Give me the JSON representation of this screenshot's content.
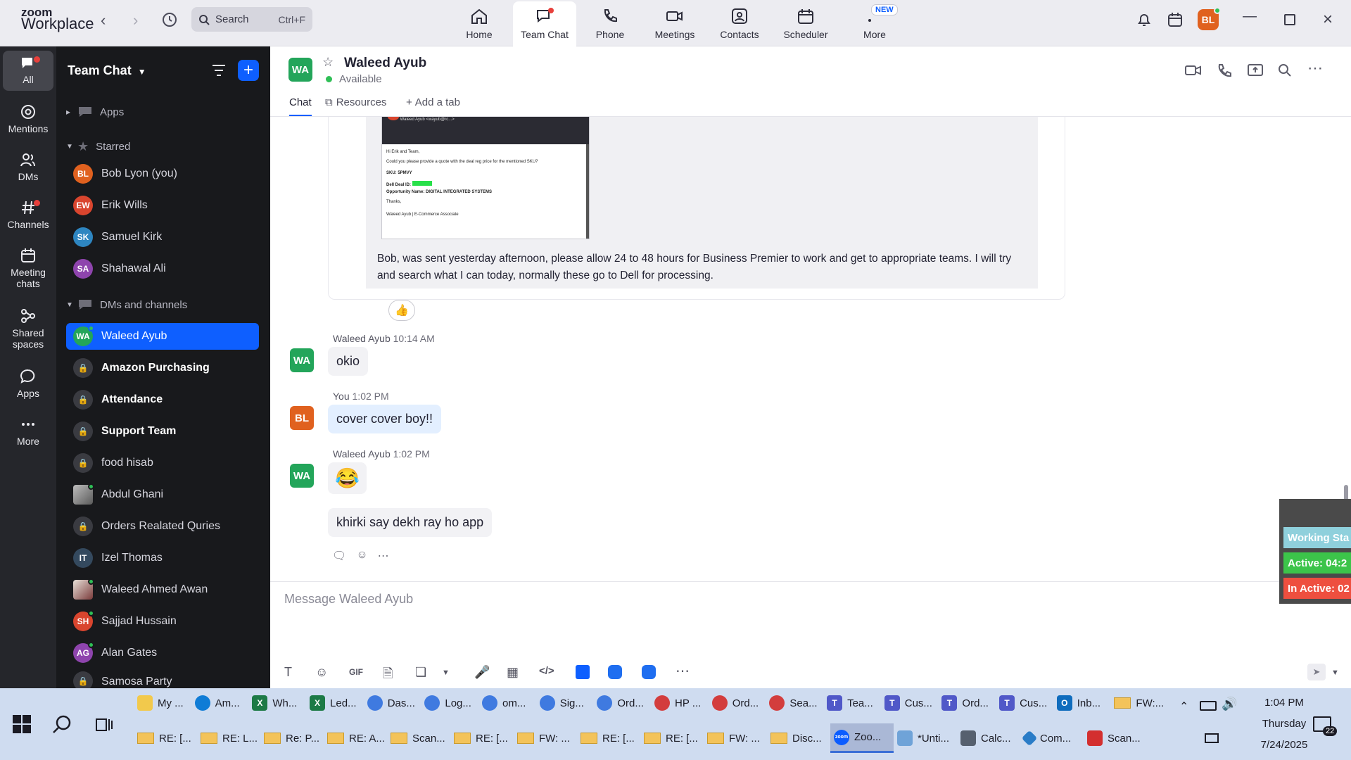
{
  "app": {
    "logo_line1": "zoom",
    "logo_line2": "Workplace"
  },
  "topbar": {
    "search_label": "Search",
    "search_shortcut": "Ctrl+F",
    "tabs": [
      {
        "label": "Home",
        "icon": "home-icon"
      },
      {
        "label": "Team Chat",
        "icon": "chat-icon"
      },
      {
        "label": "Phone",
        "icon": "phone-icon"
      },
      {
        "label": "Meetings",
        "icon": "video-icon"
      },
      {
        "label": "Contacts",
        "icon": "contacts-icon"
      },
      {
        "label": "Scheduler",
        "icon": "calendar-icon"
      },
      {
        "label": "More",
        "icon": "more-icon"
      }
    ],
    "new_badge": "NEW",
    "user_initials": "BL"
  },
  "rail": {
    "items": [
      {
        "label": "All"
      },
      {
        "label": "Mentions"
      },
      {
        "label": "DMs"
      },
      {
        "label": "Channels"
      },
      {
        "label": "Meeting chats"
      },
      {
        "label": "Shared spaces"
      },
      {
        "label": "Apps"
      },
      {
        "label": "More"
      }
    ]
  },
  "sidebar": {
    "title": "Team Chat",
    "apps_label": "Apps",
    "starred_label": "Starred",
    "starred": [
      {
        "initials": "BL",
        "name": "Bob Lyon (you)",
        "color": "#e0611f"
      },
      {
        "initials": "EW",
        "name": "Erik Wills",
        "color": "#d9452e"
      },
      {
        "initials": "SK",
        "name": "Samuel Kirk",
        "color": "#2e86c1"
      },
      {
        "initials": "SA",
        "name": "Shahawal Ali",
        "color": "#8e44ad"
      }
    ],
    "dms_label": "DMs and channels",
    "dms": [
      {
        "initials": "WA",
        "name": "Waleed Ayub",
        "color": "#23a55a"
      },
      {
        "name": "Amazon Purchasing"
      },
      {
        "name": "Attendance"
      },
      {
        "name": "Support Team"
      },
      {
        "name": "food hisab"
      },
      {
        "name": "Abdul Ghani"
      },
      {
        "name": "Orders Realated Quries"
      },
      {
        "initials": "IT",
        "name": "Izel Thomas",
        "color": "#34495e"
      },
      {
        "name": "Waleed Ahmed Awan"
      },
      {
        "initials": "SH",
        "name": "Sajjad Hussain",
        "color": "#d9452e"
      },
      {
        "initials": "AG",
        "name": "Alan Gates",
        "color": "#8e44ad"
      },
      {
        "name": "Samosa Party"
      }
    ]
  },
  "chat": {
    "contact_initials": "WA",
    "contact_name": "Waleed Ayub",
    "status": "Available",
    "tabs": {
      "chat": "Chat",
      "resources": "Resources",
      "add": "Add a tab"
    },
    "quoted_text": "Bob, was sent yesterday afternoon, please allow 24 to 48 hours for Business Premier to work and get to appropriate teams.  I will try and search what I can today, normally these go to Dell for processing.",
    "thumb": {
      "from": "Waleed Ayub <wayub@rc...>",
      "line1": "Hi Erik and Team,",
      "line2": "Could you please provide a quote with the deal reg price for the mentioned SKU?",
      "sku": "SKU: 5PMVY",
      "deal": "Dell Deal ID:",
      "opportunity": "Opportunity Name: DIGITAL INTEGRATED SYSTEMS",
      "thanks": "Thanks,",
      "sig": "Waleed Ayub | E-Commerce Associate"
    },
    "reaction": "👍",
    "messages": [
      {
        "initials": "WA",
        "sender": "Waleed Ayub",
        "time": "10:14 AM",
        "text": "okio"
      },
      {
        "initials": "BL",
        "sender": "You",
        "time": "1:02 PM",
        "text": "cover cover boy!!"
      },
      {
        "initials": "WA",
        "sender": "Waleed Ayub",
        "time": "1:02 PM",
        "text": "😂"
      },
      {
        "text": "khirki say dekh ray ho app"
      }
    ],
    "compose_placeholder": "Message Waleed Ayub",
    "gif_label": "GIF"
  },
  "work_panel": {
    "title": "Working Sta",
    "active": "Active: 04:2",
    "inactive": "In Active: 02"
  },
  "taskbar": {
    "row1": [
      "My ...",
      "Am...",
      "Wh...",
      "Led...",
      "Das...",
      "Log...",
      "om...",
      "Sig...",
      "Ord...",
      "HP ...",
      "Ord...",
      "Sea...",
      "Tea...",
      "Cus...",
      "Ord...",
      "Cus...",
      "Inb...",
      "FW:..."
    ],
    "row2": [
      "RE: [...",
      "RE: L...",
      "Re: P...",
      "RE: A...",
      "Scan...",
      "RE: [...",
      "FW: ...",
      "RE: [...",
      "RE: [...",
      "FW: ...",
      "Disc...",
      "Zoo...",
      "*Unti...",
      "Calc...",
      "Com...",
      "Scan..."
    ],
    "time": "1:04 PM",
    "day": "Thursday",
    "date": "7/24/2025",
    "notif_count": "22"
  }
}
